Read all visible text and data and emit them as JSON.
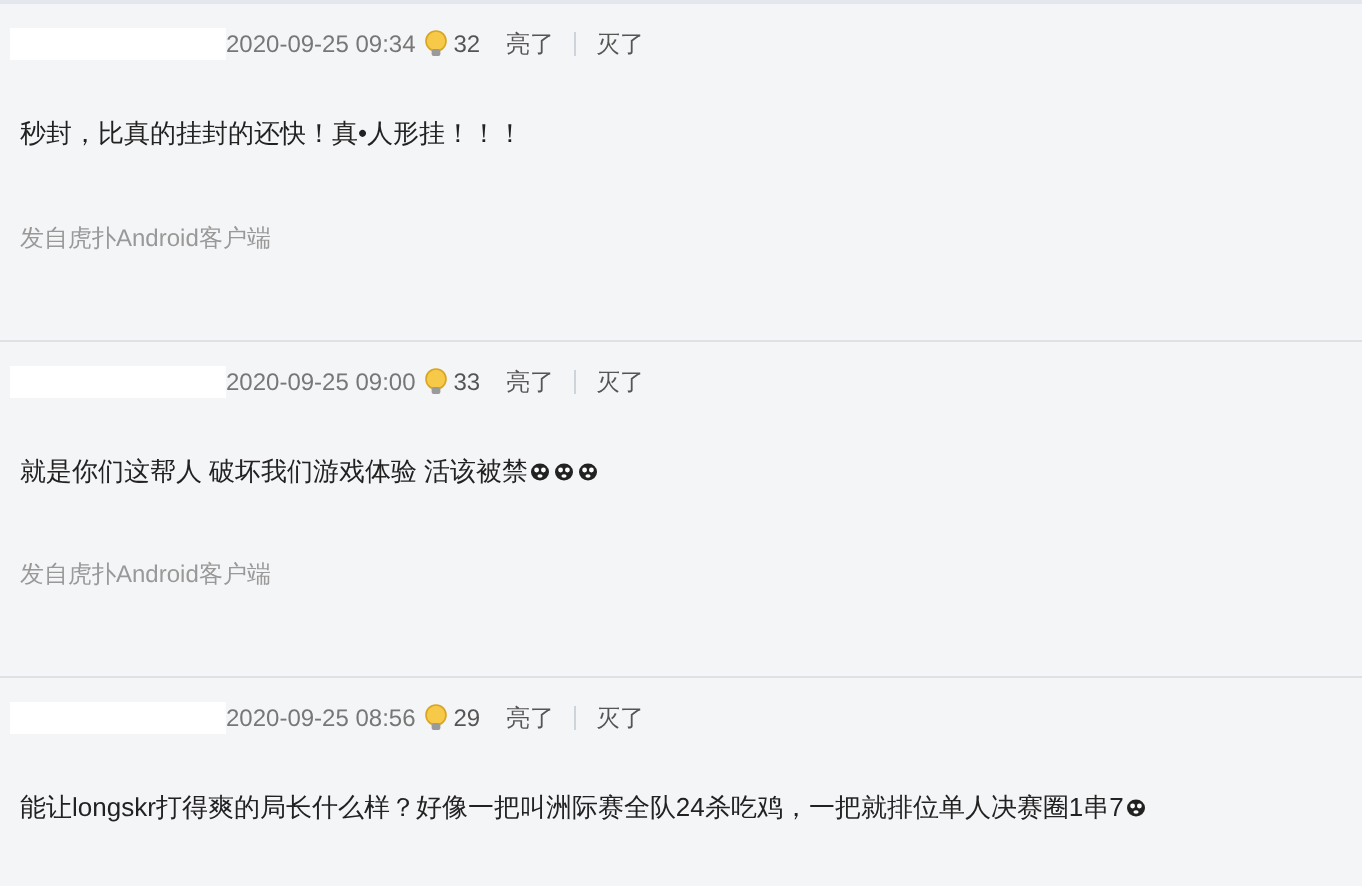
{
  "posts": [
    {
      "name_hidden": true,
      "time": "2020-09-25 09:34",
      "likes": "32",
      "like_label": "亮了",
      "dislike_label": "灭了",
      "body": "秒封，比真的挂封的还快！真•人形挂！！！",
      "source": "发自虎扑Android客户端"
    },
    {
      "name_hidden": true,
      "time": "2020-09-25 09:00",
      "likes": "33",
      "like_label": "亮了",
      "dislike_label": "灭了",
      "body": "就是你们这帮人 破坏我们游戏体验 活该被禁",
      "emojis": [
        {
          "kind": "dog"
        },
        {
          "kind": "dog"
        },
        {
          "kind": "dog"
        }
      ],
      "source": "发自虎扑Android客户端"
    },
    {
      "name_hidden": true,
      "time": "2020-09-25 08:56",
      "likes": "29",
      "like_label": "亮了",
      "dislike_label": "灭了",
      "body": "能让longskr打得爽的局长什么样？好像一把叫洲际赛全队24杀吃鸡，一把就排位单人决赛圈1串7",
      "emojis": [
        {
          "kind": "dog"
        }
      ]
    }
  ]
}
